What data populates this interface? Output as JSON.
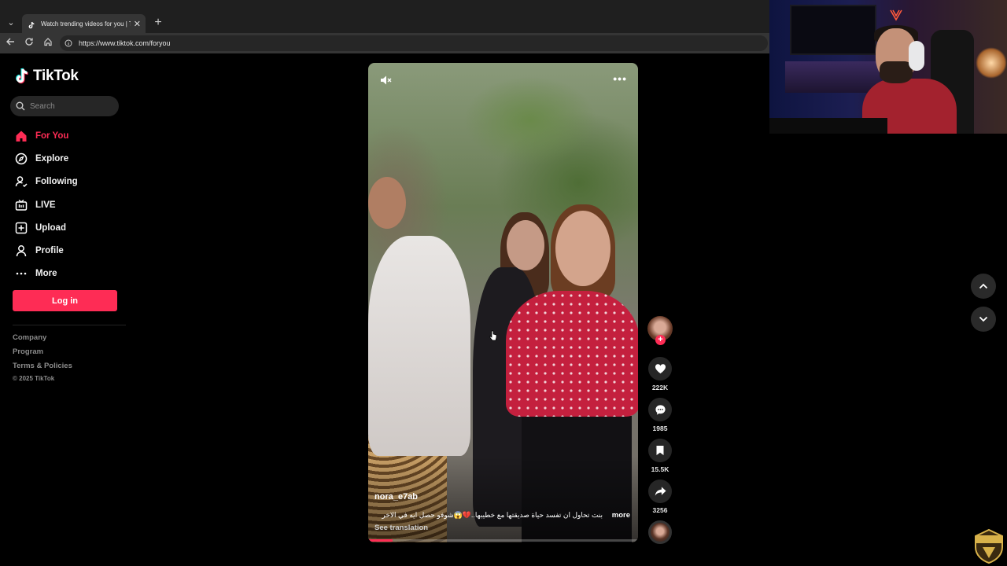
{
  "browser": {
    "tab_title": "Watch trending videos for you | TikTok",
    "tab_close": "✕",
    "new_tab": "+",
    "url": "https://www.tiktok.com/foryou"
  },
  "sidebar": {
    "logo_text": "TikTok",
    "search_placeholder": "Search",
    "items": [
      {
        "label": "For You",
        "icon": "home-icon",
        "active": true
      },
      {
        "label": "Explore",
        "icon": "compass-icon"
      },
      {
        "label": "Following",
        "icon": "user-follow-icon"
      },
      {
        "label": "LIVE",
        "icon": "live-tv-icon"
      },
      {
        "label": "Upload",
        "icon": "upload-plus-icon"
      },
      {
        "label": "Profile",
        "icon": "user-icon"
      },
      {
        "label": "More",
        "icon": "ellipsis-icon"
      }
    ],
    "login_label": "Log in",
    "footer": [
      "Company",
      "Program",
      "Terms & Policies"
    ],
    "copyright": "© 2025 TikTok"
  },
  "video": {
    "author": "nora_e7ab",
    "caption": "بنت تحاول ان تفسد حياة صديقتها مع خطيبها..💔😱شوفو حصل ايه في الاخر",
    "caption_more": "more",
    "translate_label": "See translation",
    "progress": 0.09
  },
  "actions": {
    "likes": "222K",
    "comments": "1985",
    "saves": "15.5K",
    "shares": "3256"
  },
  "colors": {
    "accent": "#fe2c55",
    "background": "#000000",
    "button_bg": "#262626"
  }
}
